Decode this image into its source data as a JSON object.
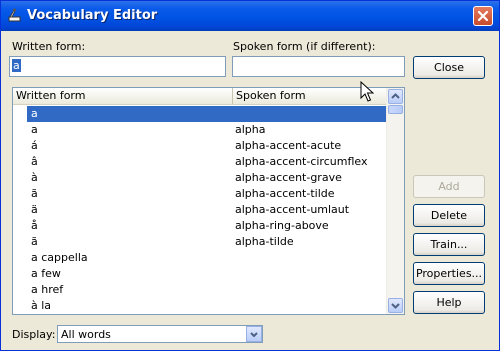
{
  "window": {
    "title": "Vocabulary Editor"
  },
  "fields": {
    "written_label": "Written form:",
    "written_value": "a",
    "spoken_label": "Spoken form (if different):",
    "spoken_value": ""
  },
  "list": {
    "headers": [
      "Written form",
      "Spoken form"
    ],
    "rows": [
      {
        "written": "a",
        "spoken": ""
      },
      {
        "written": "a",
        "spoken": "alpha"
      },
      {
        "written": "á",
        "spoken": "alpha-accent-acute"
      },
      {
        "written": "â",
        "spoken": "alpha-accent-circumflex"
      },
      {
        "written": "à",
        "spoken": "alpha-accent-grave"
      },
      {
        "written": "ã",
        "spoken": "alpha-accent-tilde"
      },
      {
        "written": "ä",
        "spoken": "alpha-accent-umlaut"
      },
      {
        "written": "å",
        "spoken": "alpha-ring-above"
      },
      {
        "written": "ã",
        "spoken": "alpha-tilde"
      },
      {
        "written": "a cappella",
        "spoken": ""
      },
      {
        "written": "a few",
        "spoken": ""
      },
      {
        "written": "a href",
        "spoken": ""
      },
      {
        "written": "à la",
        "spoken": ""
      }
    ]
  },
  "buttons": {
    "close": "Close",
    "add": "Add",
    "delete": "Delete",
    "train": "Train...",
    "properties": "Properties...",
    "help": "Help"
  },
  "display": {
    "label": "Display:",
    "value": "All words"
  }
}
